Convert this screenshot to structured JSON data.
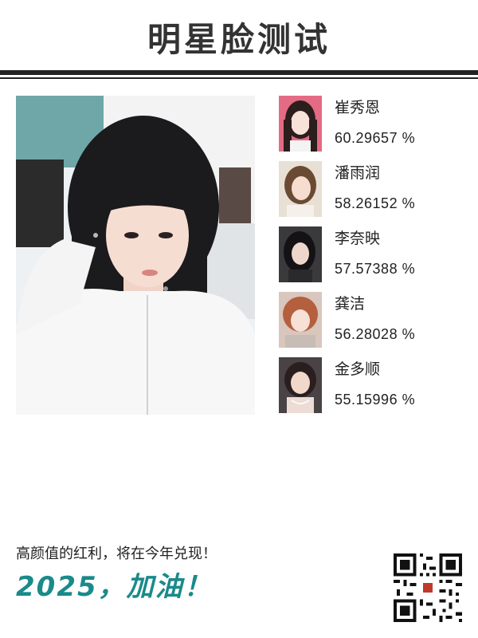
{
  "header": {
    "title": "明星脸测试"
  },
  "photo": {
    "alt": "user selfie",
    "icon": "user-photo"
  },
  "matches": [
    {
      "name": "崔秀恩",
      "score": "60.29657 %"
    },
    {
      "name": "潘雨润",
      "score": "58.26152 %"
    },
    {
      "name": "李奈映",
      "score": "57.57388 %"
    },
    {
      "name": "龚洁",
      "score": "56.28028 %"
    },
    {
      "name": "金多顺",
      "score": "55.15996 %"
    }
  ],
  "footer": {
    "tagline": "高颜值的红利，将在今年兑现！",
    "slogan": "2025，加油！",
    "qr_icon": "qr-code-icon"
  },
  "colors": {
    "accent": "#1a8a8a",
    "text": "#222222",
    "rule": "#222222"
  }
}
